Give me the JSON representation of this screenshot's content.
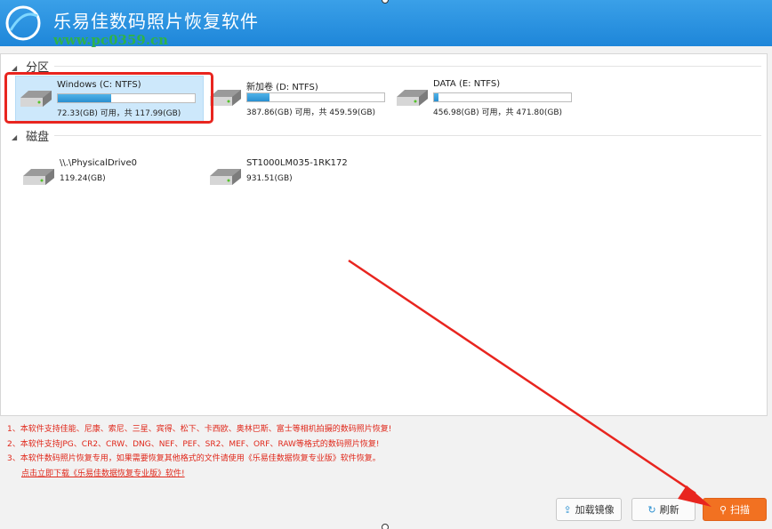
{
  "app": {
    "title": "乐易佳数码照片恢复软件",
    "watermark": "www.pc0359.cn",
    "minimize_icon": "minimize-icon",
    "close_icon": "close-icon"
  },
  "partitions": {
    "heading": "分区",
    "drives": [
      {
        "name": "Windows (C: NTFS)",
        "free_text": "72.33(GB) 可用，共 117.99(GB)",
        "used_fraction": 0.39
      },
      {
        "name": "新加卷 (D: NTFS)",
        "free_text": "387.86(GB) 可用，共 459.59(GB)",
        "used_fraction": 0.16
      },
      {
        "name": "DATA (E: NTFS)",
        "free_text": "456.98(GB) 可用，共 471.80(GB)",
        "used_fraction": 0.03
      }
    ]
  },
  "disks": {
    "heading": "磁盘",
    "items": [
      {
        "name": "\\\\.\\PhysicalDrive0",
        "size": "119.24(GB)"
      },
      {
        "name": "ST1000LM035-1RK172",
        "size": "931.51(GB)"
      }
    ]
  },
  "notes": {
    "line1": "1、本软件支持佳能、尼康、索尼、三星、宾得、松下、卡西欧、奥林巴斯、富士等相机拍摄的数码照片恢复!",
    "line2": "2、本软件支持JPG、CR2、CRW、DNG、NEF、PEF、SR2、MEF、ORF、RAW等格式的数码照片恢复!",
    "line3": "3、本软件数码照片恢复专用，如果需要恢复其他格式的文件请使用《乐易佳数据恢复专业版》软件恢复。",
    "link": "点击立即下载《乐易佳数据恢复专业版》软件!"
  },
  "toolbar": {
    "mount_label": "加载镜像",
    "refresh_label": "刷新",
    "scan_label": "扫描"
  },
  "colors": {
    "titlebar": "#1e86d9",
    "scan_button": "#f27121",
    "annotation": "#e8251f"
  }
}
